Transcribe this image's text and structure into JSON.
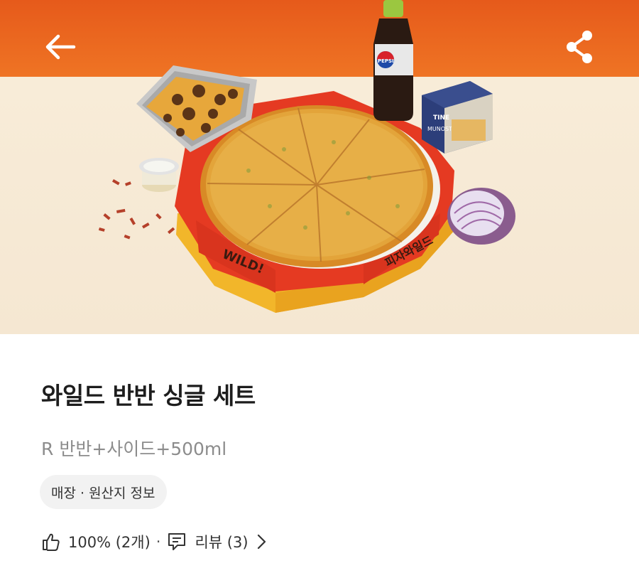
{
  "header": {
    "back_icon": "arrow-left-icon",
    "share_icon": "share-icon"
  },
  "hero": {
    "box_print_1": "WILD!",
    "box_print_2": "피자와일드",
    "bottle_label": "PEPSI",
    "carton_label_1": "TINE",
    "carton_label_2": "MUNOST"
  },
  "product": {
    "title": "와일드 반반 싱글 세트",
    "subtitle": "R 반반+사이드+500ml",
    "info_chip": "매장 · 원산지 정보"
  },
  "stats": {
    "like_icon": "thumbs-up-icon",
    "rating": "100% (2개)",
    "separator": "·",
    "review_icon": "comment-icon",
    "review_label": "리뷰 (3)",
    "chevron_icon": "chevron-right-icon"
  },
  "colors": {
    "wall": "#e65a1b",
    "table": "#f6ead9",
    "chip_bg": "#f2f2f2",
    "subtitle": "#8c8c8c"
  }
}
